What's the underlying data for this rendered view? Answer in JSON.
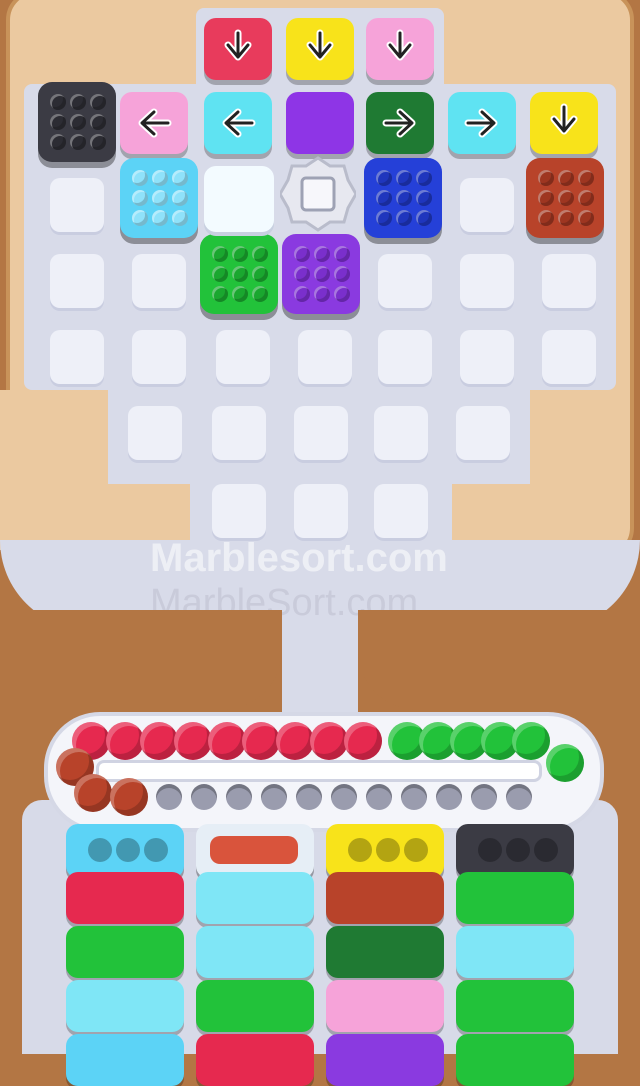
{
  "watermarks": {
    "primary": "Marblesort.com",
    "secondary": "MarbleSort.com"
  },
  "colors": {
    "wood": "#b37644",
    "wood_light": "#ebc9a0",
    "board": "#d8dbe9",
    "slot": "#eef0f8"
  },
  "arrow_tiles": [
    {
      "row": "top",
      "col": 3,
      "color": "#e83b5c",
      "arrow": "down"
    },
    {
      "row": "top",
      "col": 4,
      "color": "#f8e31a",
      "arrow": "down"
    },
    {
      "row": "top",
      "col": 5,
      "color": "#f6a3d9",
      "arrow": "down"
    },
    {
      "row": "second",
      "col": 2,
      "color": "#f6a3d9",
      "arrow": "left"
    },
    {
      "row": "second",
      "col": 3,
      "color": "#5fe3f2",
      "arrow": "left"
    },
    {
      "row": "second",
      "col": 4,
      "color": "#8e35e6",
      "arrow": "none"
    },
    {
      "row": "second",
      "col": 5,
      "color": "#1f7a33",
      "arrow": "right"
    },
    {
      "row": "second",
      "col": 6,
      "color": "#5fe3f2",
      "arrow": "right"
    },
    {
      "row": "second",
      "col": 7,
      "color": "#f8e31a",
      "arrow": "down"
    }
  ],
  "marble_boxes": [
    {
      "name": "black-box",
      "color": "#3b3b44",
      "dot": "#2c2c33"
    },
    {
      "name": "light-blue-box",
      "color": "#5cd3f6",
      "dot": "#8fe2fa"
    },
    {
      "name": "blue-box",
      "color": "#2540d8",
      "dot": "#1f36bd"
    },
    {
      "name": "red-box",
      "color": "#b8432a",
      "dot": "#9e3621"
    },
    {
      "name": "green-box",
      "color": "#22c23a",
      "dot": "#1aa72f"
    },
    {
      "name": "purple-box",
      "color": "#8a3ae0",
      "dot": "#7a2fcc"
    }
  ],
  "conveyor": {
    "marbles": [
      "#e6294f",
      "#e6294f",
      "#e6294f",
      "#e6294f",
      "#e6294f",
      "#e6294f",
      "#e6294f",
      "#e6294f",
      "#e6294f",
      "#22c23a",
      "#22c23a",
      "#22c23a",
      "#22c23a",
      "#22c23a",
      "#22c23a",
      "#b8432a",
      "#b8432a",
      "#b8432a"
    ],
    "holes": 11
  },
  "bins": {
    "columns": [
      [
        "#5cd3f6",
        "#e6294f",
        "#22c23a",
        "#7fe6f6",
        "#5cd3f6"
      ],
      [
        "#e6eef6",
        "#7fe6f6",
        "#7fe6f6",
        "#22c23a",
        "#e6294f"
      ],
      [
        "#f8e31a",
        "#b8432a",
        "#1f7a33",
        "#f6a3d9",
        "#8a3ae0"
      ],
      [
        "#3b3b44",
        "#22c23a",
        "#7fe6f6",
        "#22c23a",
        "#22c23a"
      ]
    ]
  }
}
